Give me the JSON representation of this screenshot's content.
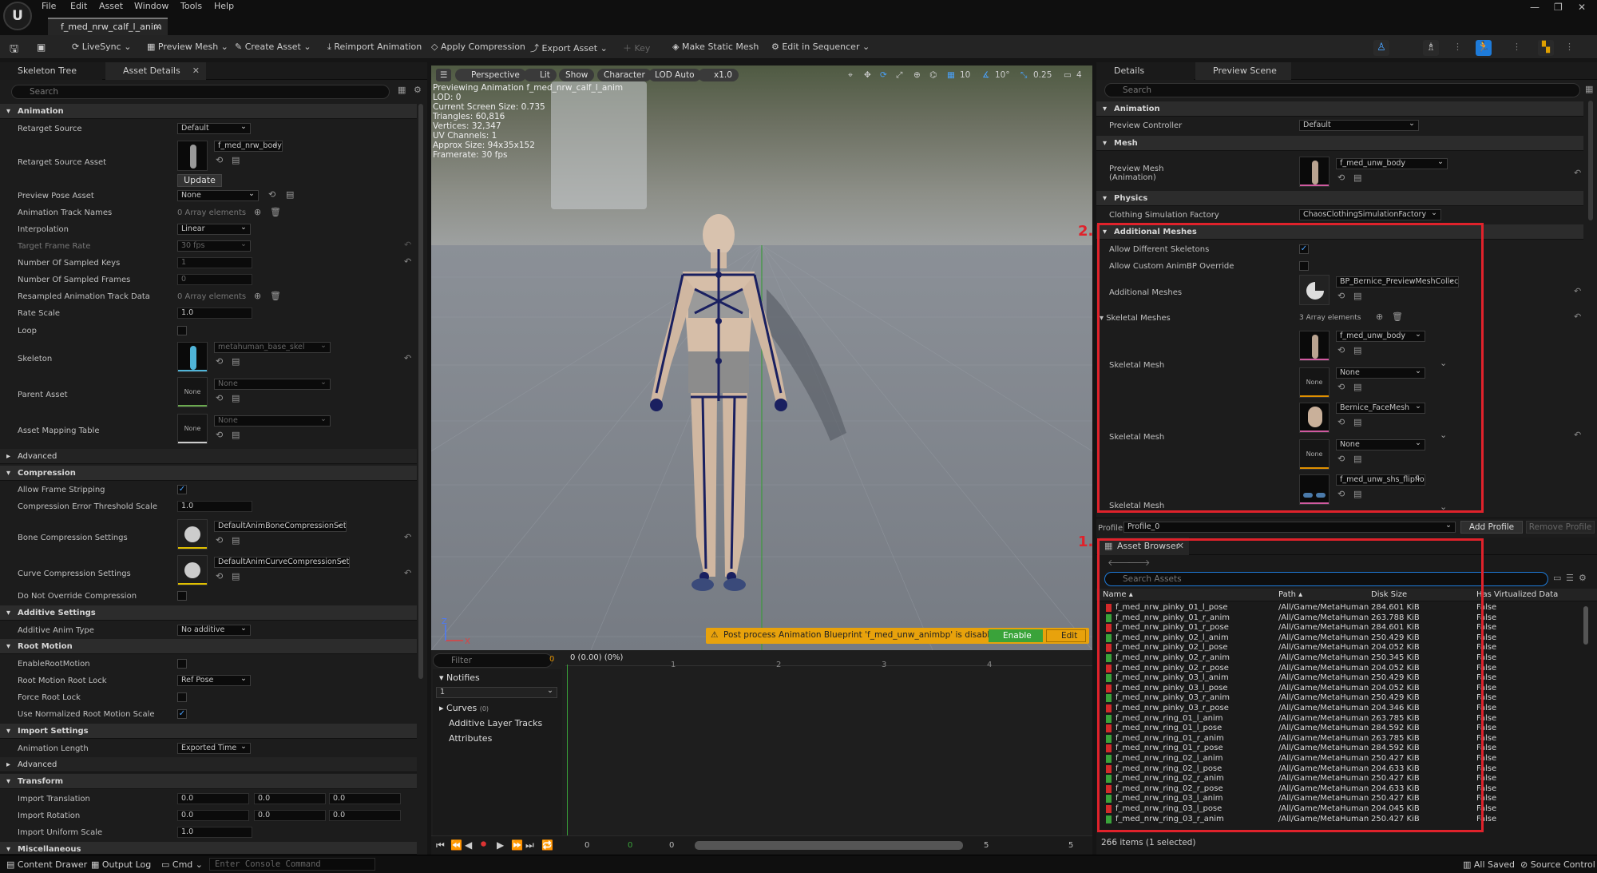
{
  "menu": {
    "items": [
      "File",
      "Edit",
      "Asset",
      "Window",
      "Tools",
      "Help"
    ]
  },
  "doc_tab": "f_med_nrw_calf_l_anim",
  "toolbar": {
    "livesync": "LiveSync",
    "preview_mesh": "Preview Mesh",
    "create_asset": "Create Asset",
    "reimport": "Reimport Animation",
    "apply_compression": "Apply Compression",
    "export_asset": "Export Asset",
    "key": "Key",
    "make_static_mesh": "Make Static Mesh",
    "edit_in_sequencer": "Edit in Sequencer"
  },
  "left_panel": {
    "tabs": [
      "Skeleton Tree",
      "Asset Details"
    ],
    "search_placeholder": "Search",
    "sections": {
      "animation": "Animation",
      "advanced": "Advanced",
      "compression": "Compression",
      "additive": "Additive Settings",
      "root_motion": "Root Motion",
      "import": "Import Settings",
      "advanced2": "Advanced",
      "transform": "Transform",
      "misc": "Miscellaneous"
    },
    "props": {
      "retarget_source": {
        "label": "Retarget Source",
        "value": "Default"
      },
      "retarget_source_asset": {
        "label": "Retarget Source Asset",
        "value": "f_med_nrw_body",
        "button": "Update"
      },
      "preview_pose_asset": {
        "label": "Preview Pose Asset",
        "value": "None"
      },
      "animation_track_names": {
        "label": "Animation Track Names",
        "value": "0 Array elements"
      },
      "interpolation": {
        "label": "Interpolation",
        "value": "Linear"
      },
      "target_frame_rate": {
        "label": "Target Frame Rate",
        "value": "30 fps"
      },
      "sampled_keys": {
        "label": "Number Of Sampled Keys",
        "value": "1"
      },
      "sampled_frames": {
        "label": "Number Of Sampled Frames",
        "value": "0"
      },
      "resampled": {
        "label": "Resampled Animation Track Data",
        "value": "0 Array elements"
      },
      "rate_scale": {
        "label": "Rate Scale",
        "value": "1.0"
      },
      "loop": {
        "label": "Loop"
      },
      "skeleton": {
        "label": "Skeleton",
        "value": "metahuman_base_skel"
      },
      "parent_asset": {
        "label": "Parent Asset",
        "value": "None",
        "thumb": "None"
      },
      "asset_mapping": {
        "label": "Asset Mapping Table",
        "value": "None",
        "thumb": "None"
      },
      "allow_frame_stripping": {
        "label": "Allow Frame Stripping"
      },
      "compression_error": {
        "label": "Compression Error Threshold Scale",
        "value": "1.0"
      },
      "bone_compression": {
        "label": "Bone Compression Settings",
        "value": "DefaultAnimBoneCompressionSettings"
      },
      "curve_compression": {
        "label": "Curve Compression Settings",
        "value": "DefaultAnimCurveCompressionSettings"
      },
      "do_not_override": {
        "label": "Do Not Override Compression"
      },
      "additive_anim_type": {
        "label": "Additive Anim Type",
        "value": "No additive"
      },
      "enable_root_motion": {
        "label": "EnableRootMotion"
      },
      "root_motion_lock": {
        "label": "Root Motion Root Lock",
        "value": "Ref Pose"
      },
      "force_root_lock": {
        "label": "Force Root Lock"
      },
      "normalized_root": {
        "label": "Use Normalized Root Motion Scale"
      },
      "animation_length": {
        "label": "Animation Length",
        "value": "Exported Time"
      },
      "import_translation": {
        "label": "Import Translation",
        "values": [
          "0.0",
          "0.0",
          "0.0"
        ]
      },
      "import_rotation": {
        "label": "Import Rotation",
        "values": [
          "0.0",
          "0.0",
          "0.0"
        ]
      },
      "import_uniform_scale": {
        "label": "Import Uniform Scale",
        "value": "1.0"
      }
    }
  },
  "viewport": {
    "buttons": {
      "perspective": "Perspective",
      "lit": "Lit",
      "show": "Show",
      "character": "Character",
      "lod": "LOD Auto",
      "speed": "x1.0"
    },
    "right_icons": {
      "grid": "10",
      "angle": "10°",
      "scale": "0.25",
      "camera": "4"
    },
    "stats": [
      "Previewing Animation f_med_nrw_calf_l_anim",
      "LOD: 0",
      "Current Screen Size: 0.735",
      "Triangles: 60,816",
      "Vertices: 32,347",
      "UV Channels: 1",
      "Approx Size: 94x35x152",
      "Framerate: 30 fps"
    ],
    "warning": {
      "text": "Post process Animation Blueprint 'f_med_unw_animbp' is disabled.",
      "enable": "Enable",
      "edit": "Edit"
    }
  },
  "timeline": {
    "filter_placeholder": "Filter",
    "filter_count": "0",
    "notifies": "Notifies",
    "notify_track": "1",
    "curves": "Curves",
    "curves_count": "(0)",
    "additive_layer": "Additive Layer Tracks",
    "attributes": "Attributes",
    "time_label": "0 (0.00) (0%)",
    "ticks": [
      "1",
      "2",
      "3",
      "4"
    ],
    "bottom_nums": [
      "0",
      "0",
      "0",
      "5",
      "5"
    ]
  },
  "details": {
    "tabs": [
      "Details",
      "Preview Scene S..."
    ],
    "search_placeholder": "Search",
    "sections": {
      "animation": "Animation",
      "mesh": "Mesh",
      "physics": "Physics",
      "additional": "Additional Meshes"
    },
    "preview_controller": {
      "label": "Preview Controller",
      "value": "Default"
    },
    "preview_mesh": {
      "label1": "Preview Mesh",
      "label2": "(Animation)",
      "value": "f_med_unw_body"
    },
    "clothing": {
      "label": "Clothing Simulation Factory",
      "value": "ChaosClothingSimulationFactory"
    },
    "allow_diff_skel": {
      "label": "Allow Different Skeletons"
    },
    "allow_custom_animbp": {
      "label": "Allow Custom AnimBP Override"
    },
    "additional_meshes": {
      "label": "Additional Meshes",
      "value": "BP_Bernice_PreviewMeshCollection"
    },
    "skeletal_meshes": {
      "label": "Skeletal Meshes",
      "value": "3 Array elements"
    },
    "skeletal_mesh_label": "Skeletal Mesh",
    "sm": [
      {
        "mesh": "f_med_unw_body",
        "anim": "None"
      },
      {
        "mesh": "Bernice_FaceMesh",
        "anim": "None"
      },
      {
        "mesh": "f_med_unw_shs_flipflops",
        "anim": "None"
      }
    ],
    "profile_label": "Profile",
    "profile_value": "Profile_0",
    "add_profile": "Add Profile",
    "remove_profile": "Remove Profile"
  },
  "annotations": {
    "a1": "1.",
    "a2": "2."
  },
  "asset_browser": {
    "tab": "Asset Browser",
    "search_placeholder": "Search Assets",
    "columns": [
      "Name",
      "Path",
      "Disk Size",
      "Has Virtualized Data"
    ],
    "rows": [
      {
        "name": "f_med_nrw_pinky_01_l_pose",
        "path": "/All/Game/MetaHuman",
        "size": "284.601 KiB",
        "virt": "False",
        "kind": "pose"
      },
      {
        "name": "f_med_nrw_pinky_01_r_anim",
        "path": "/All/Game/MetaHuman",
        "size": "263.788 KiB",
        "virt": "False",
        "kind": "anim"
      },
      {
        "name": "f_med_nrw_pinky_01_r_pose",
        "path": "/All/Game/MetaHuman",
        "size": "284.601 KiB",
        "virt": "False",
        "kind": "pose"
      },
      {
        "name": "f_med_nrw_pinky_02_l_anim",
        "path": "/All/Game/MetaHuman",
        "size": "250.429 KiB",
        "virt": "False",
        "kind": "anim"
      },
      {
        "name": "f_med_nrw_pinky_02_l_pose",
        "path": "/All/Game/MetaHuman",
        "size": "204.052 KiB",
        "virt": "False",
        "kind": "pose"
      },
      {
        "name": "f_med_nrw_pinky_02_r_anim",
        "path": "/All/Game/MetaHuman",
        "size": "250.345 KiB",
        "virt": "False",
        "kind": "anim"
      },
      {
        "name": "f_med_nrw_pinky_02_r_pose",
        "path": "/All/Game/MetaHuman",
        "size": "204.052 KiB",
        "virt": "False",
        "kind": "pose"
      },
      {
        "name": "f_med_nrw_pinky_03_l_anim",
        "path": "/All/Game/MetaHuman",
        "size": "250.429 KiB",
        "virt": "False",
        "kind": "anim"
      },
      {
        "name": "f_med_nrw_pinky_03_l_pose",
        "path": "/All/Game/MetaHuman",
        "size": "204.052 KiB",
        "virt": "False",
        "kind": "pose"
      },
      {
        "name": "f_med_nrw_pinky_03_r_anim",
        "path": "/All/Game/MetaHuman",
        "size": "250.429 KiB",
        "virt": "False",
        "kind": "anim"
      },
      {
        "name": "f_med_nrw_pinky_03_r_pose",
        "path": "/All/Game/MetaHuman",
        "size": "204.346 KiB",
        "virt": "False",
        "kind": "pose"
      },
      {
        "name": "f_med_nrw_ring_01_l_anim",
        "path": "/All/Game/MetaHuman",
        "size": "263.785 KiB",
        "virt": "False",
        "kind": "anim"
      },
      {
        "name": "f_med_nrw_ring_01_l_pose",
        "path": "/All/Game/MetaHuman",
        "size": "284.592 KiB",
        "virt": "False",
        "kind": "pose"
      },
      {
        "name": "f_med_nrw_ring_01_r_anim",
        "path": "/All/Game/MetaHuman",
        "size": "263.785 KiB",
        "virt": "False",
        "kind": "anim"
      },
      {
        "name": "f_med_nrw_ring_01_r_pose",
        "path": "/All/Game/MetaHuman",
        "size": "284.592 KiB",
        "virt": "False",
        "kind": "pose"
      },
      {
        "name": "f_med_nrw_ring_02_l_anim",
        "path": "/All/Game/MetaHuman",
        "size": "250.427 KiB",
        "virt": "False",
        "kind": "anim"
      },
      {
        "name": "f_med_nrw_ring_02_l_pose",
        "path": "/All/Game/MetaHuman",
        "size": "204.633 KiB",
        "virt": "False",
        "kind": "pose"
      },
      {
        "name": "f_med_nrw_ring_02_r_anim",
        "path": "/All/Game/MetaHuman",
        "size": "250.427 KiB",
        "virt": "False",
        "kind": "anim"
      },
      {
        "name": "f_med_nrw_ring_02_r_pose",
        "path": "/All/Game/MetaHuman",
        "size": "204.633 KiB",
        "virt": "False",
        "kind": "pose"
      },
      {
        "name": "f_med_nrw_ring_03_l_anim",
        "path": "/All/Game/MetaHuman",
        "size": "250.427 KiB",
        "virt": "False",
        "kind": "anim"
      },
      {
        "name": "f_med_nrw_ring_03_l_pose",
        "path": "/All/Game/MetaHuman",
        "size": "204.045 KiB",
        "virt": "False",
        "kind": "pose"
      },
      {
        "name": "f_med_nrw_ring_03_r_anim",
        "path": "/All/Game/MetaHuman",
        "size": "250.427 KiB",
        "virt": "False",
        "kind": "anim"
      }
    ],
    "status": "266 items (1 selected)"
  },
  "statusbar": {
    "content_drawer": "Content Drawer",
    "output_log": "Output Log",
    "cmd": "Cmd",
    "console_placeholder": "Enter Console Command",
    "all_saved": "All Saved",
    "source_control": "Source Control"
  },
  "colors": {
    "anim_icon": "#3aa33a",
    "pose_icon": "#d42a2a",
    "annotation": "#e0222b",
    "accent": "#1e7bd9"
  }
}
